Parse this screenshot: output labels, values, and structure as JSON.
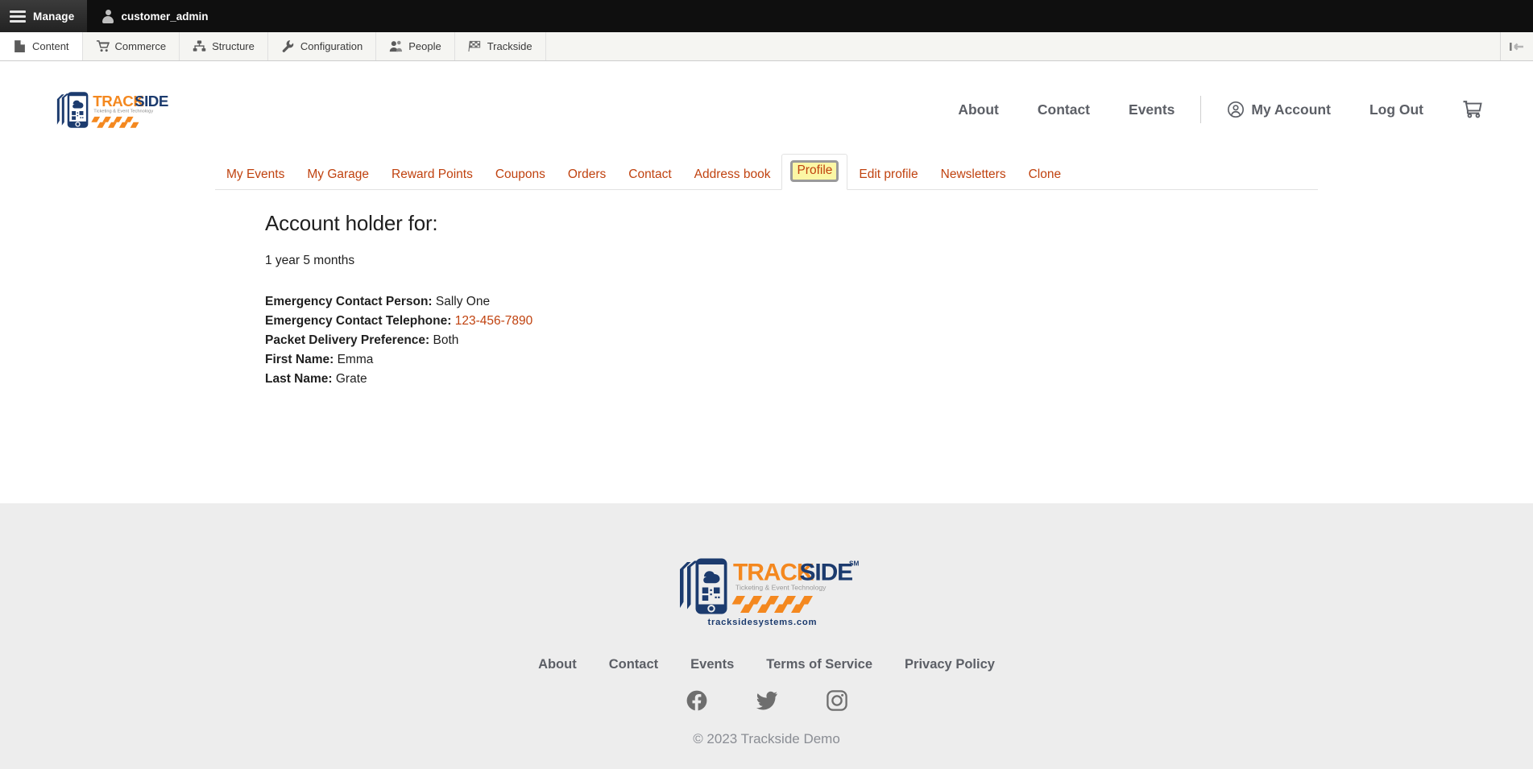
{
  "admin_toolbar": {
    "home_label": "Manage",
    "home_icon": "hamburger-menu-icon",
    "user_name": "customer_admin",
    "user_icon": "user-account-icon",
    "tray_items": [
      {
        "label": "Content",
        "icon": "document-page-icon",
        "active": true
      },
      {
        "label": "Commerce",
        "icon": "shopping-cart-icon",
        "active": false
      },
      {
        "label": "Structure",
        "icon": "sitemap-hierarchy-icon",
        "active": false
      },
      {
        "label": "Configuration",
        "icon": "wrench-icon",
        "active": false
      },
      {
        "label": "People",
        "icon": "people-group-icon",
        "active": false
      },
      {
        "label": "Trackside",
        "icon": "checkered-flag-icon",
        "active": false
      }
    ],
    "orientation_toggle_icon": "toolbar-orientation-toggle-icon"
  },
  "header": {
    "logo": {
      "name": "trackside-logo",
      "word_one": "TRACK",
      "word_two": "SIDE",
      "tagline": "Ticketing & Event Technology"
    },
    "nav": [
      {
        "label": "About",
        "name": "header-nav-about"
      },
      {
        "label": "Contact",
        "name": "header-nav-contact"
      },
      {
        "label": "Events",
        "name": "header-nav-events"
      }
    ],
    "account_label": "My Account",
    "account_icon": "user-circle-icon",
    "logout_label": "Log Out",
    "cart_icon": "shopping-cart-icon"
  },
  "tabs": [
    {
      "label": "My Events",
      "active": false
    },
    {
      "label": "My Garage",
      "active": false
    },
    {
      "label": "Reward Points",
      "active": false
    },
    {
      "label": "Coupons",
      "active": false
    },
    {
      "label": "Orders",
      "active": false
    },
    {
      "label": "Contact",
      "active": false
    },
    {
      "label": "Address book",
      "active": false
    },
    {
      "label": "Profile",
      "active": true
    },
    {
      "label": "Edit profile",
      "active": false
    },
    {
      "label": "Newsletters",
      "active": false
    },
    {
      "label": "Clone",
      "active": false
    }
  ],
  "main": {
    "page_title": "Account holder for:",
    "membership_length": "1 year 5 months",
    "fields": [
      {
        "label": "Emergency Contact Person:",
        "value": "Sally One",
        "is_link": false
      },
      {
        "label": "Emergency Contact Telephone:",
        "value": "123-456-7890",
        "is_link": true
      },
      {
        "label": "Packet Delivery Preference:",
        "value": "Both",
        "is_link": false
      },
      {
        "label": "First Name:",
        "value": "Emma",
        "is_link": false
      },
      {
        "label": "Last Name:",
        "value": "Grate",
        "is_link": false
      }
    ]
  },
  "footer": {
    "logo": {
      "name": "trackside-footer-logo",
      "word_one": "TRACK",
      "word_two": "SIDE",
      "superscript": "SM",
      "tagline": "Ticketing & Event Technology",
      "website": "tracksidesystems.com"
    },
    "nav": [
      {
        "label": "About",
        "name": "footer-nav-about"
      },
      {
        "label": "Contact",
        "name": "footer-nav-contact"
      },
      {
        "label": "Events",
        "name": "footer-nav-events"
      },
      {
        "label": "Terms of Service",
        "name": "footer-nav-terms-of-service"
      },
      {
        "label": "Privacy Policy",
        "name": "footer-nav-privacy-policy"
      }
    ],
    "social": [
      {
        "name": "facebook-icon"
      },
      {
        "name": "twitter-icon"
      },
      {
        "name": "instagram-icon"
      }
    ],
    "copyright": "© 2023 Trackside Demo"
  },
  "colors": {
    "brand_orange": "#F4881F",
    "brand_navy": "#1C3B6E",
    "link_rust": "#c0420f",
    "toolbar_dark": "#0f0f0f",
    "footer_bg": "#ededed",
    "highlight_yellow": "#fbf7a5"
  }
}
